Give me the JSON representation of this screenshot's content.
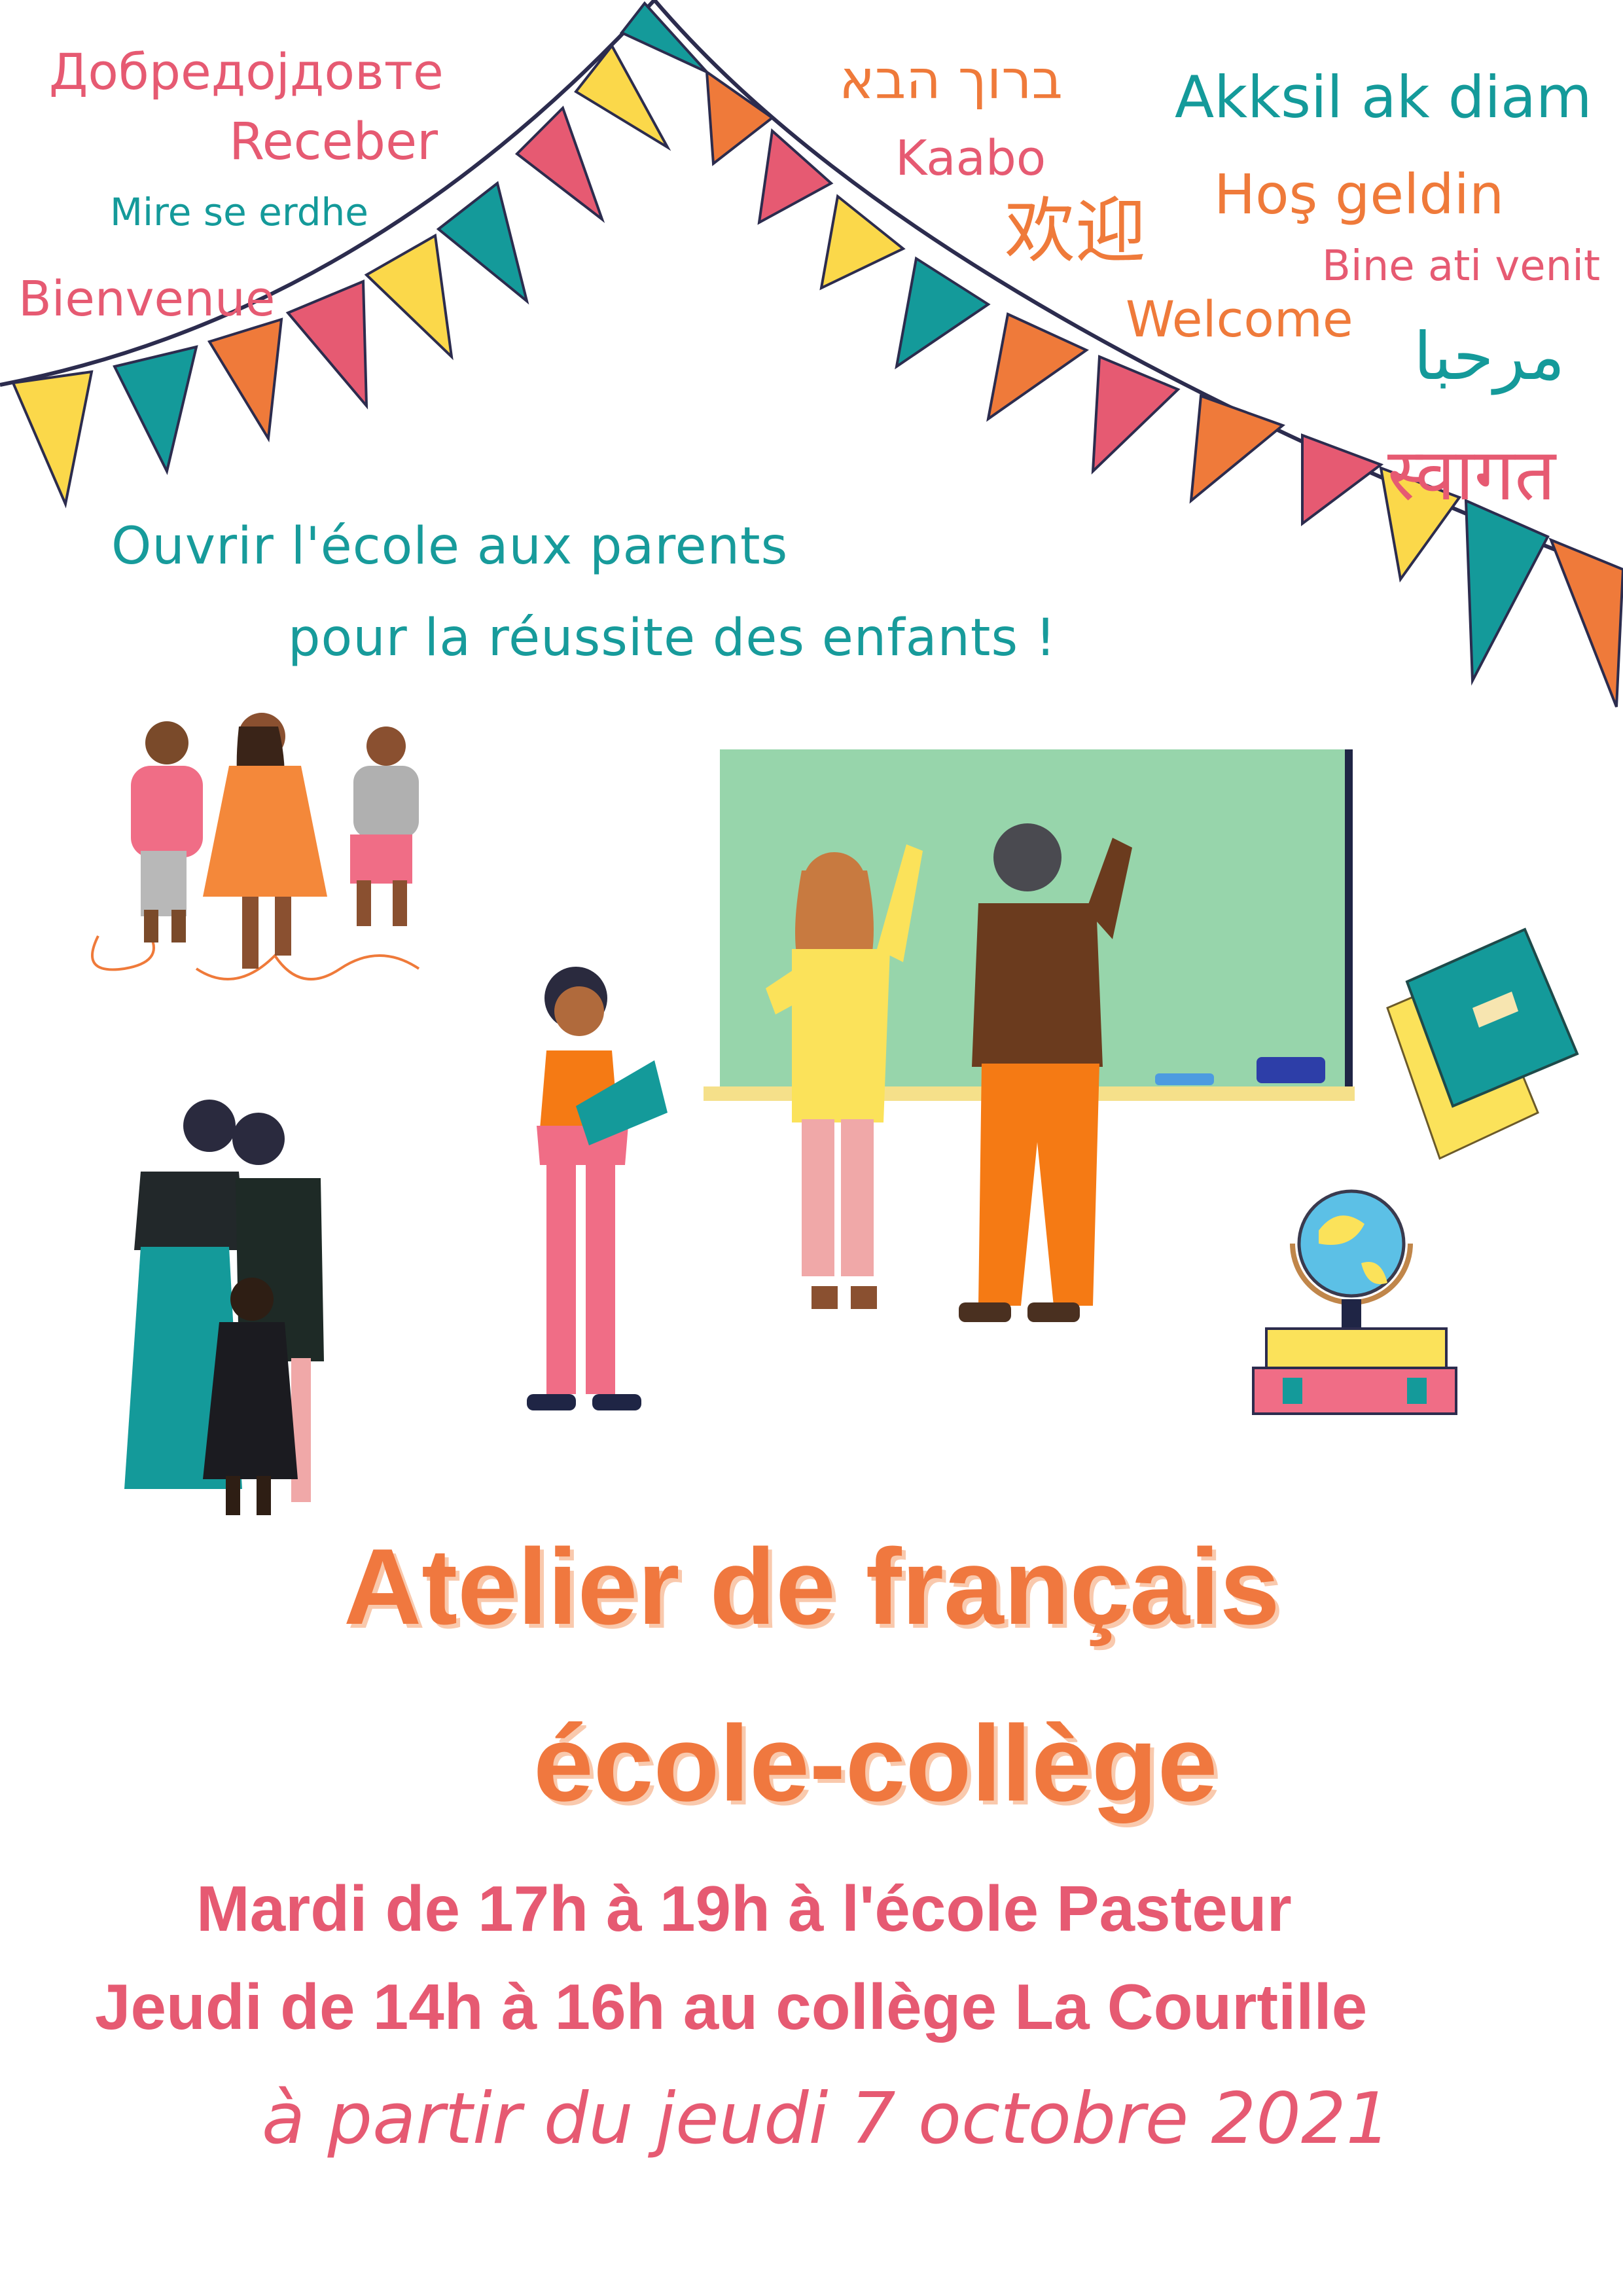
{
  "welcome_words": {
    "macedonian": "Добредојдовте",
    "portuguese": "Receber",
    "albanian": "Mire se erdhe",
    "french": "Bienvenue",
    "hebrew": "ברוך הבא",
    "yoruba": "Kaabo",
    "chinese": "欢迎",
    "wolof": "Akksil ak diam",
    "turkish": "Hoş geldin",
    "romanian": "Bine ati venit",
    "english": "Welcome",
    "arabic": "مرحبا",
    "hindi": "स्वागत"
  },
  "tagline": {
    "line1": "Ouvrir l'école aux parents",
    "line2": "pour la réussite des enfants !"
  },
  "title": {
    "line1": "Atelier de français",
    "line2": "école-collège"
  },
  "schedule": {
    "tuesday": "Mardi de 17h à 19h à l'école Pasteur",
    "thursday": "Jeudi de 14h à 16h au collège La Courtille"
  },
  "start_date": "à partir du jeudi 7 octobre 2021",
  "colors": {
    "pink": "#e65a72",
    "orange": "#ef7a3a",
    "teal": "#149a9a",
    "yellow": "#fbd84a"
  }
}
